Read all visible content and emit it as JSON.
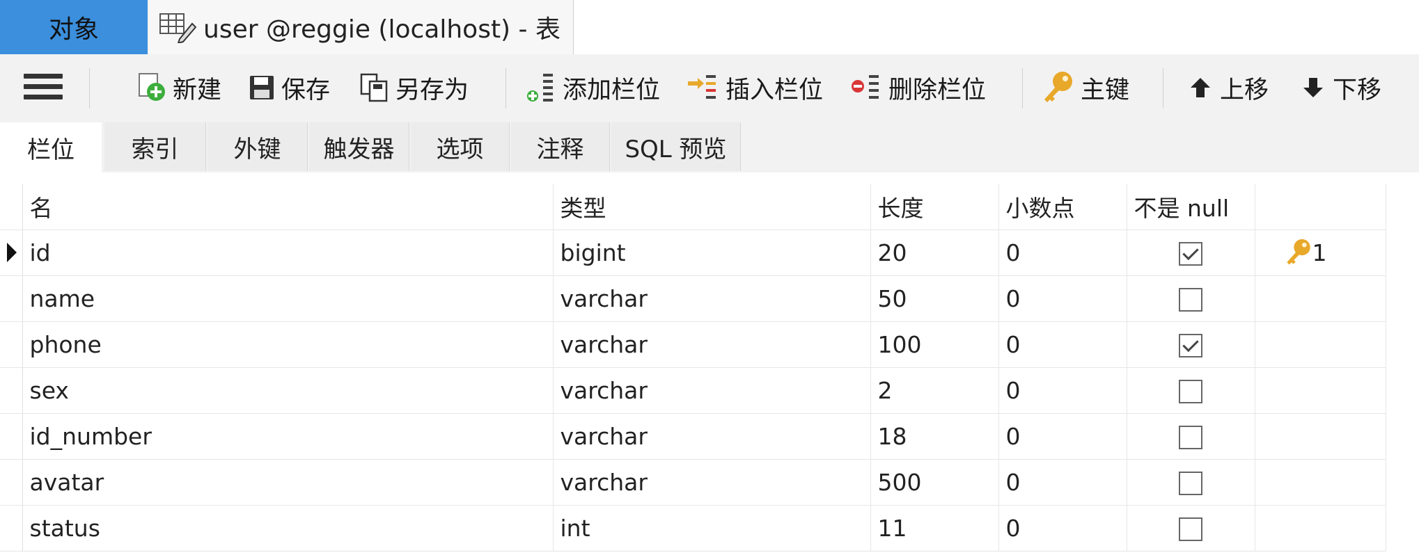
{
  "tabs": {
    "objects_label": "对象",
    "table_tab_label": "user @reggie (localhost) - 表"
  },
  "toolbar": {
    "menu_icon": "hamburger-menu-icon",
    "new_label": "新建",
    "save_label": "保存",
    "save_as_label": "另存为",
    "add_field_label": "添加栏位",
    "insert_field_label": "插入栏位",
    "delete_field_label": "删除栏位",
    "primary_key_label": "主键",
    "move_up_label": "上移",
    "move_down_label": "下移"
  },
  "subtabs": [
    "栏位",
    "索引",
    "外键",
    "触发器",
    "选项",
    "注释",
    "SQL 预览"
  ],
  "grid": {
    "headers": [
      "名",
      "类型",
      "长度",
      "小数点",
      "不是 null",
      ""
    ],
    "rows": [
      {
        "name": "id",
        "type": "bigint",
        "length": "20",
        "decimals": "0",
        "not_null": true,
        "key": "1"
      },
      {
        "name": "name",
        "type": "varchar",
        "length": "50",
        "decimals": "0",
        "not_null": false,
        "key": ""
      },
      {
        "name": "phone",
        "type": "varchar",
        "length": "100",
        "decimals": "0",
        "not_null": true,
        "key": ""
      },
      {
        "name": "sex",
        "type": "varchar",
        "length": "2",
        "decimals": "0",
        "not_null": false,
        "key": ""
      },
      {
        "name": "id_number",
        "type": "varchar",
        "length": "18",
        "decimals": "0",
        "not_null": false,
        "key": ""
      },
      {
        "name": "avatar",
        "type": "varchar",
        "length": "500",
        "decimals": "0",
        "not_null": false,
        "key": ""
      },
      {
        "name": "status",
        "type": "int",
        "length": "11",
        "decimals": "0",
        "not_null": false,
        "key": ""
      }
    ]
  },
  "colors": {
    "accent_tab": "#3b8fdd",
    "key_icon": "#e8a82a",
    "add_icon": "#3cae3c",
    "delete_icon": "#d93636"
  }
}
